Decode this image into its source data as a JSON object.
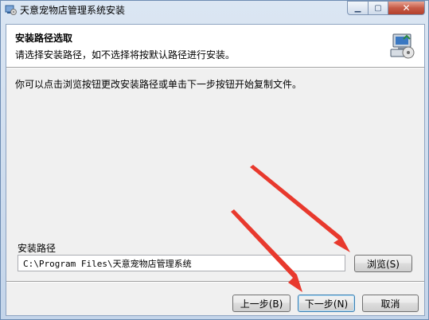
{
  "window": {
    "title": "天意宠物店管理系统安装",
    "icon": "installer-icon",
    "controls": {
      "minimize": "minimize-icon",
      "maximize": "maximize-icon",
      "close": "close-icon"
    }
  },
  "banner": {
    "title": "安装路径选取",
    "subtitle": "请选择安装路径，如不选择将按默认路径进行安装。",
    "icon": "setup-computer-icon"
  },
  "main": {
    "instruction": "你可以点击浏览按钮更改安装路径或单击下一步按钮开始复制文件。",
    "path_label": "安装路径",
    "path_value": "C:\\Program Files\\天意宠物店管理系统",
    "browse_label": "浏览(S)"
  },
  "footer": {
    "back_label": "上一步(B)",
    "next_label": "下一步(N)",
    "cancel_label": "取消"
  },
  "annotations": {
    "arrow_color": "#e8392d"
  }
}
